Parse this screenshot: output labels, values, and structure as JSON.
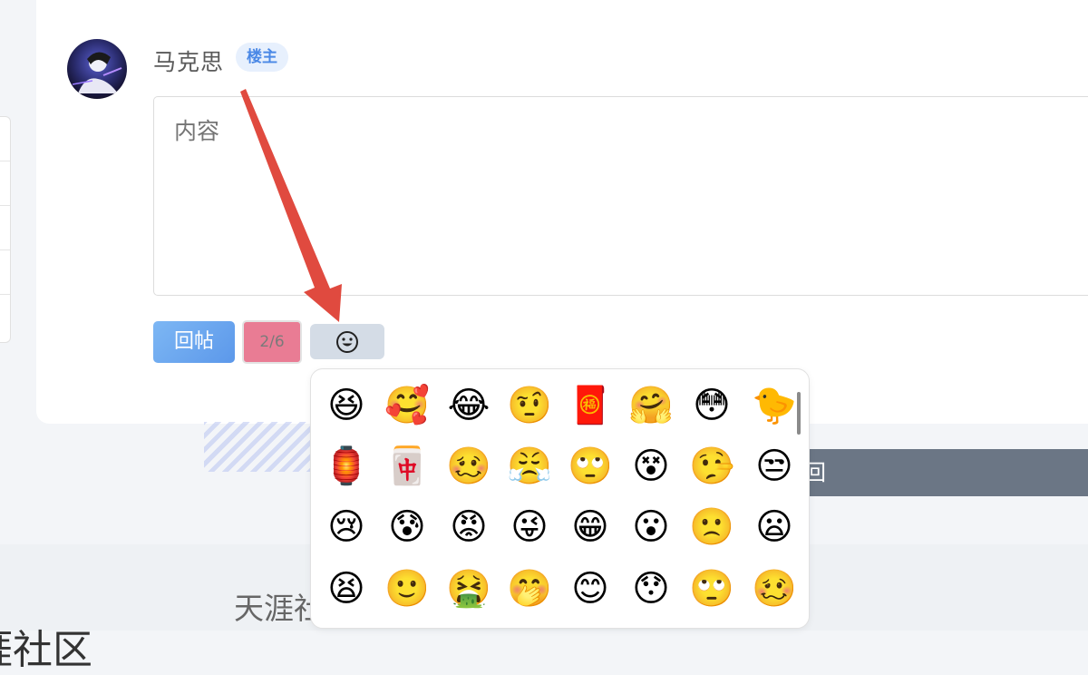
{
  "post": {
    "username": "马克思",
    "owner_badge": "楼主"
  },
  "reply_box": {
    "placeholder": "内容"
  },
  "toolbar": {
    "reply_label": "回帖",
    "image_count": "2/6",
    "emoji_icon": "smiley-face-icon"
  },
  "background": {
    "bar_text": "回",
    "footer_title": "天涯社",
    "footer_big": "涯社区"
  },
  "emoji_picker": {
    "emojis": [
      "😆",
      "🥰",
      "😂",
      "🤨",
      "🧧",
      "🤗",
      "😳",
      "🐤",
      "🏮",
      "🀄",
      "🥴",
      "😤",
      "🙄",
      "😵",
      "🤥",
      "😒",
      "😢",
      "😰",
      "😡",
      "😜",
      "😁",
      "😮",
      "🙁",
      "😦",
      "😫",
      "🙂",
      "🤮",
      "🤭",
      "😊",
      "😯",
      "🙄",
      "🥴"
    ]
  },
  "colors": {
    "reply_button": "#5c98ea",
    "image_count_bg": "#e97c94",
    "arrow": "#e04a3f",
    "badge_text": "#4a88e6"
  }
}
